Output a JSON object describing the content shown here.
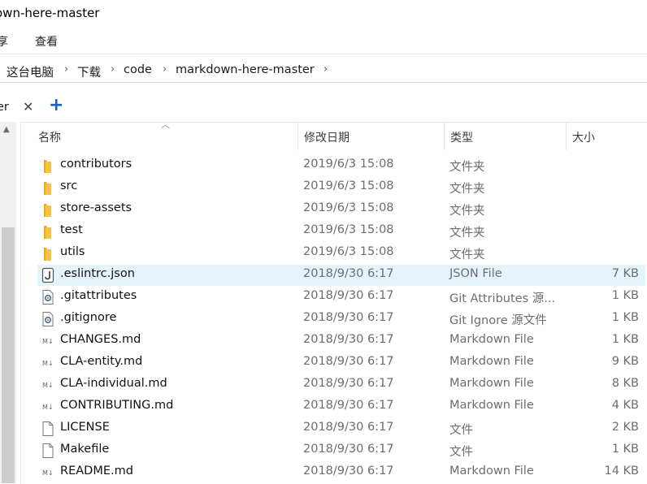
{
  "window": {
    "title": "own-here-master"
  },
  "ribbon": {
    "tab_share": "享",
    "tab_view": "查看"
  },
  "breadcrumb": {
    "items": [
      "这台电脑",
      "下载",
      "code",
      "markdown-here-master"
    ]
  },
  "tabstrip": {
    "tab_label": "er",
    "close_glyph": "✕",
    "new_tab_glyph": "+"
  },
  "columns": {
    "name": "名称",
    "modified": "修改日期",
    "type": "类型",
    "size": "大小"
  },
  "colors": {
    "folder": "#f6c344",
    "selected_row": "#e5f3fb",
    "new_tab": "#1a5fb4"
  },
  "files": [
    {
      "name": "contributors",
      "date": "2019/6/3 15:08",
      "type": "文件夹",
      "size": "",
      "icon": "folder-icon"
    },
    {
      "name": "src",
      "date": "2019/6/3 15:08",
      "type": "文件夹",
      "size": "",
      "icon": "folder-icon"
    },
    {
      "name": "store-assets",
      "date": "2019/6/3 15:08",
      "type": "文件夹",
      "size": "",
      "icon": "folder-icon"
    },
    {
      "name": "test",
      "date": "2019/6/3 15:08",
      "type": "文件夹",
      "size": "",
      "icon": "folder-icon"
    },
    {
      "name": "utils",
      "date": "2019/6/3 15:08",
      "type": "文件夹",
      "size": "",
      "icon": "folder-icon"
    },
    {
      "name": ".eslintrc.json",
      "date": "2018/9/30 6:17",
      "type": "JSON File",
      "size": "7 KB",
      "icon": "json-file-icon",
      "selected": true
    },
    {
      "name": ".gitattributes",
      "date": "2018/9/30 6:17",
      "type": "Git Attributes 源...",
      "size": "1 KB",
      "icon": "settings-file-icon"
    },
    {
      "name": ".gitignore",
      "date": "2018/9/30 6:17",
      "type": "Git Ignore 源文件",
      "size": "1 KB",
      "icon": "settings-file-icon"
    },
    {
      "name": "CHANGES.md",
      "date": "2018/9/30 6:17",
      "type": "Markdown File",
      "size": "1 KB",
      "icon": "markdown-file-icon"
    },
    {
      "name": "CLA-entity.md",
      "date": "2018/9/30 6:17",
      "type": "Markdown File",
      "size": "9 KB",
      "icon": "markdown-file-icon"
    },
    {
      "name": "CLA-individual.md",
      "date": "2018/9/30 6:17",
      "type": "Markdown File",
      "size": "8 KB",
      "icon": "markdown-file-icon"
    },
    {
      "name": "CONTRIBUTING.md",
      "date": "2018/9/30 6:17",
      "type": "Markdown File",
      "size": "4 KB",
      "icon": "markdown-file-icon"
    },
    {
      "name": "LICENSE",
      "date": "2018/9/30 6:17",
      "type": "文件",
      "size": "2 KB",
      "icon": "blank-file-icon"
    },
    {
      "name": "Makefile",
      "date": "2018/9/30 6:17",
      "type": "文件",
      "size": "1 KB",
      "icon": "blank-file-icon"
    },
    {
      "name": "README.md",
      "date": "2018/9/30 6:17",
      "type": "Markdown File",
      "size": "14 KB",
      "icon": "markdown-file-icon"
    }
  ]
}
